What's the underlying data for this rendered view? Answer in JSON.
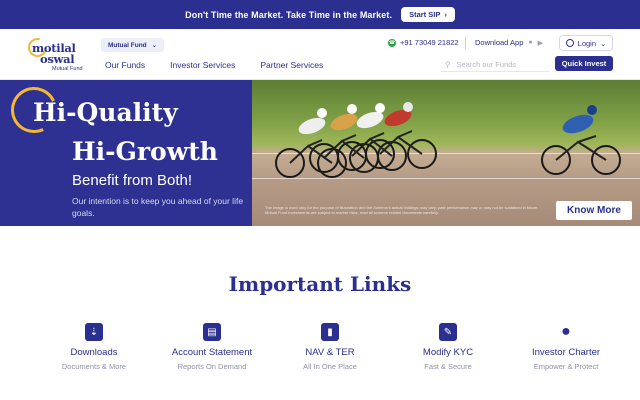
{
  "topbar": {
    "text": "Don't Time the Market. Take Time in the Market.",
    "cta_label": "Start SIP",
    "cta_icon": "chevron-right-icon",
    "background": "#2b2f8f"
  },
  "header": {
    "logo": {
      "line1": "motilal",
      "line2": "oswal",
      "sub": "Mutual Fund"
    },
    "product_dropdown": {
      "selected": "Mutual Fund"
    },
    "nav": [
      "Our Funds",
      "Investor Services",
      "Partner Services"
    ],
    "phone": "+91 73049 21822",
    "download_app": "Download App",
    "login_label": "Login",
    "search_placeholder": "Search our Funds",
    "quick_invest_label": "Quick Invest"
  },
  "banner": {
    "headline_line1": "Hi-Quality",
    "headline_line2": "Hi-Growth",
    "headline_line3": "Benefit from Both!",
    "subtext": "Our intention is to keep you ahead of your life goals.",
    "disclaimer_line1": "The image is used only for the purpose of illustration and the Scheme's actual holdings may vary; past performance may or may not be sustained in future.",
    "disclaimer_line2": "Mutual Fund investments are subject to market risks, read all scheme related documents carefully.",
    "cta_label": "Know More",
    "background": "#2e3191",
    "accent": "#f4b731"
  },
  "important_links": {
    "title": "Important Links",
    "items": [
      {
        "title": "Downloads",
        "subtitle": "Documents & More",
        "icon": "download-icon"
      },
      {
        "title": "Account Statement",
        "subtitle": "Reports On Demand",
        "icon": "document-icon"
      },
      {
        "title": "NAV & TER",
        "subtitle": "All In One Place",
        "icon": "bar-chart-icon"
      },
      {
        "title": "Modify KYC",
        "subtitle": "Fast & Secure",
        "icon": "edit-icon"
      },
      {
        "title": "Investor Charter",
        "subtitle": "Empower & Protect",
        "icon": "users-icon"
      }
    ]
  }
}
